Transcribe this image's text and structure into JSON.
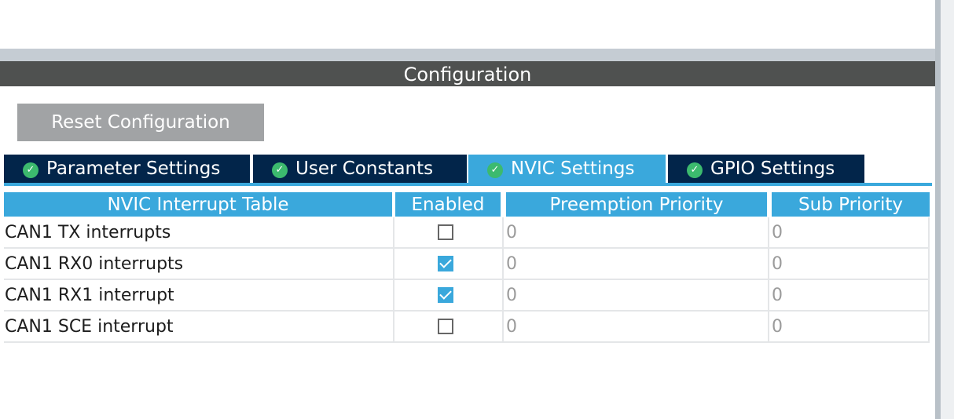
{
  "panel": {
    "title": "Configuration",
    "reset_label": "Reset Configuration"
  },
  "tabs": [
    {
      "label": "Parameter Settings",
      "active": false,
      "icon": "check-circle-icon"
    },
    {
      "label": "User Constants",
      "active": false,
      "icon": "check-circle-icon"
    },
    {
      "label": "NVIC Settings",
      "active": true,
      "icon": "check-circle-icon"
    },
    {
      "label": "GPIO Settings",
      "active": false,
      "icon": "check-circle-icon"
    }
  ],
  "table": {
    "headers": [
      "NVIC Interrupt Table",
      "Enabled",
      "Preemption Priority",
      "Sub Priority"
    ],
    "rows": [
      {
        "name": "CAN1 TX interrupts",
        "enabled": false,
        "preemption": "0",
        "sub": "0"
      },
      {
        "name": "CAN1 RX0 interrupts",
        "enabled": true,
        "preemption": "0",
        "sub": "0"
      },
      {
        "name": "CAN1 RX1 interrupt",
        "enabled": true,
        "preemption": "0",
        "sub": "0"
      },
      {
        "name": "CAN1 SCE interrupt",
        "enabled": false,
        "preemption": "0",
        "sub": "0"
      }
    ]
  },
  "colors": {
    "title_bar": "#4f5150",
    "tab_inactive": "#02254a",
    "tab_active": "#3aa8dc",
    "header": "#3aa8dc",
    "check_green": "#3cba6e",
    "reset_button": "#a1a3a5"
  }
}
